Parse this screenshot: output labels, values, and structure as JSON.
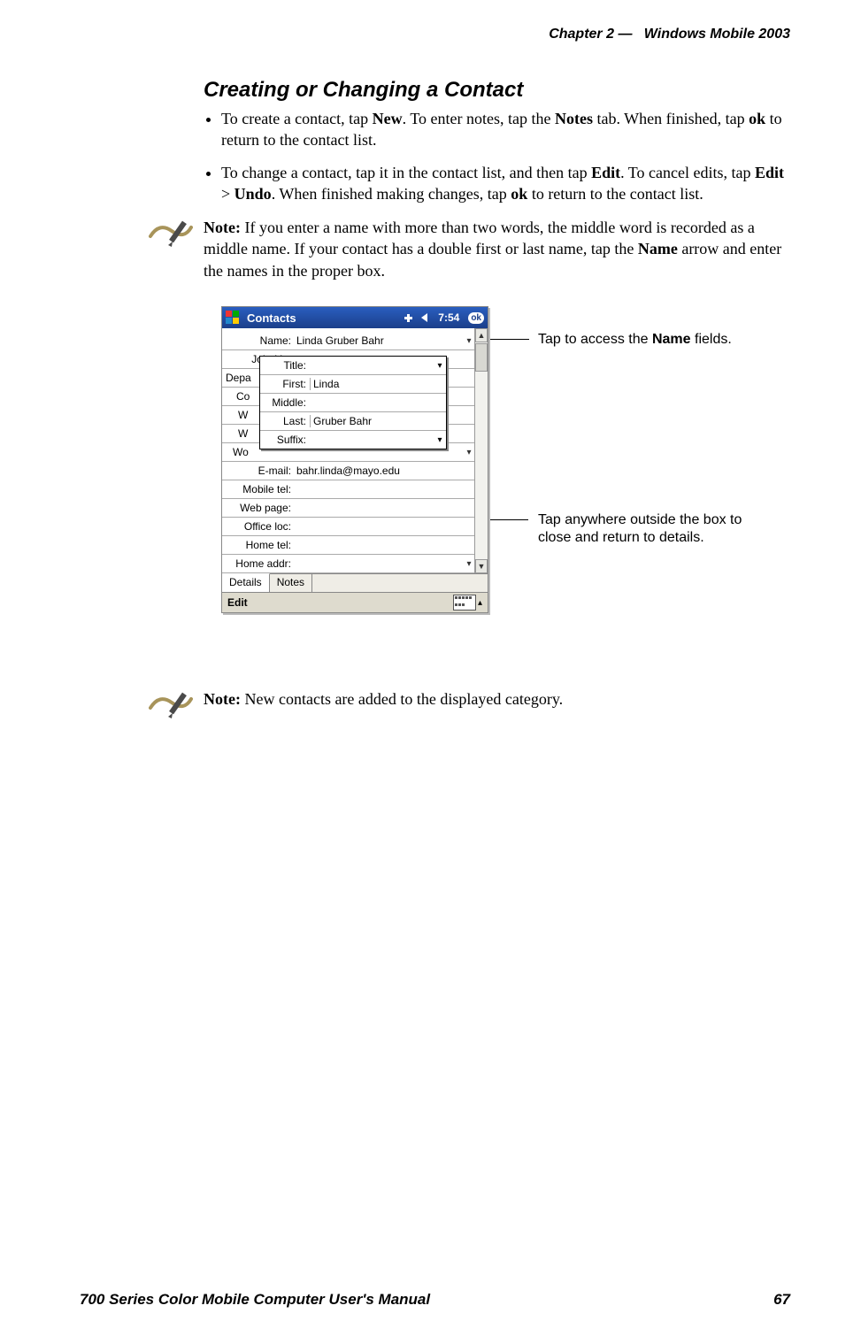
{
  "header": {
    "chapter": "Chapter  2",
    "sep": "—",
    "title": "Windows Mobile 2003"
  },
  "section_title": "Creating or Changing a Contact",
  "bullets": {
    "b1_pre": "To create a contact, tap ",
    "b1_new": "New",
    "b1_mid": ". To enter notes, tap the ",
    "b1_notes": "Notes",
    "b1_mid2": " tab. When finished, tap ",
    "b1_ok": "ok",
    "b1_end": " to return to the contact list.",
    "b2_pre": "To change a contact, tap it in the contact list, and then tap ",
    "b2_edit": "Edit",
    "b2_mid": ". To cancel edits, tap ",
    "b2_edit2": "Edit",
    "b2_gt": " > ",
    "b2_undo": "Undo",
    "b2_mid2": ". When finished making changes, tap ",
    "b2_ok": "ok",
    "b2_end": " to return to the contact list."
  },
  "note1": {
    "label": "Note:",
    "text_a": " If you enter a name with more than two words, the middle word is recorded as a middle name. If your contact has a double first or last name, tap the ",
    "name_word": "Name",
    "text_b": " arrow and enter the names in the proper box."
  },
  "note2": {
    "label": "Note:",
    "text": " New contacts are added to the displayed category."
  },
  "ppc": {
    "title": "Contacts",
    "time": "7:54",
    "ok": "ok",
    "fields": {
      "name_label": "Name:",
      "name_value": "Linda Gruber Bahr",
      "job_label": "Job title:",
      "dept_label": "Depa",
      "co_label": "Co",
      "w1_label": "W",
      "w2_label": "W",
      "wo_label": "Wo",
      "email_label": "E-mail:",
      "email_value": "bahr.linda@mayo.edu",
      "mobile_label": "Mobile tel:",
      "web_label": "Web page:",
      "officeloc_label": "Office loc:",
      "hometel_label": "Home tel:",
      "homeaddr_label": "Home addr:"
    },
    "popup": {
      "title_label": "Title:",
      "first_label": "First:",
      "first_value": "Linda",
      "middle_label": "Middle:",
      "last_label": "Last:",
      "last_value": "Gruber Bahr",
      "suffix_label": "Suffix:"
    },
    "tabs": {
      "details": "Details",
      "notes": "Notes"
    },
    "bottombar": {
      "edit": "Edit"
    }
  },
  "callouts": {
    "c1_a": "Tap to access the ",
    "c1_b": "Name",
    "c1_c": " fields.",
    "c2": "Tap anywhere outside the box to close and return to details."
  },
  "footer": {
    "left": "700 Series Color Mobile Computer User's Manual",
    "right": "67"
  }
}
